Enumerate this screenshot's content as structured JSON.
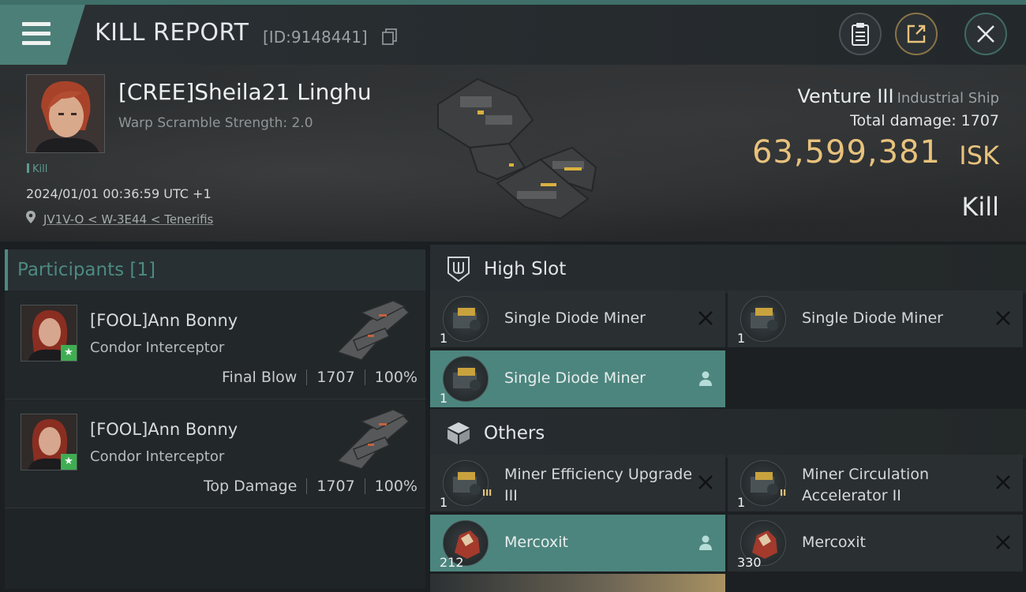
{
  "header": {
    "title": "KILL REPORT",
    "id_text": "[ID:9148441]",
    "buttons": [
      "report-icon",
      "share-icon",
      "close-icon"
    ]
  },
  "victim": {
    "name": "[CREE]Sheila21 Linghu",
    "warp_scramble": "Warp Scramble Strength: 2.0",
    "kill_tag": "Kill",
    "datetime": "2024/01/01 00:36:59 UTC +1",
    "location": "JV1V-O < W-3E44 < Tenerifis"
  },
  "ship": {
    "name": "Venture III",
    "class": "Industrial Ship",
    "total_damage_label": "Total damage:",
    "total_damage": "1707",
    "isk_value": "63,599,381",
    "isk_unit": "ISK",
    "result": "Kill"
  },
  "participants": {
    "header": "Participants [1]",
    "rows": [
      {
        "name": "[FOOL]Ann Bonny",
        "ship": "Condor Interceptor",
        "role": "Final Blow",
        "damage": "1707",
        "percent": "100%"
      },
      {
        "name": "[FOOL]Ann Bonny",
        "ship": "Condor Interceptor",
        "role": "Top Damage",
        "damage": "1707",
        "percent": "100%"
      }
    ]
  },
  "modules": {
    "high_slot": {
      "label": "High Slot",
      "items": [
        {
          "name": "Single Diode Miner",
          "qty": "1",
          "status": "destroyed"
        },
        {
          "name": "Single Diode Miner",
          "qty": "1",
          "status": "destroyed"
        },
        {
          "name": "Single Diode Miner",
          "qty": "1",
          "status": "dropped"
        }
      ]
    },
    "others": {
      "label": "Others",
      "items": [
        {
          "name": "Miner Efficiency Upgrade III",
          "qty": "1",
          "status": "destroyed"
        },
        {
          "name": "Miner Circulation Accelerator II",
          "qty": "1",
          "status": "destroyed"
        },
        {
          "name": "Mercoxit",
          "qty": "212",
          "status": "dropped"
        },
        {
          "name": "Mercoxit",
          "qty": "330",
          "status": "destroyed"
        }
      ]
    }
  },
  "colors": {
    "accent": "#4d7f79",
    "isk": "#e8c27c",
    "highlight_row": "#4c857e"
  }
}
